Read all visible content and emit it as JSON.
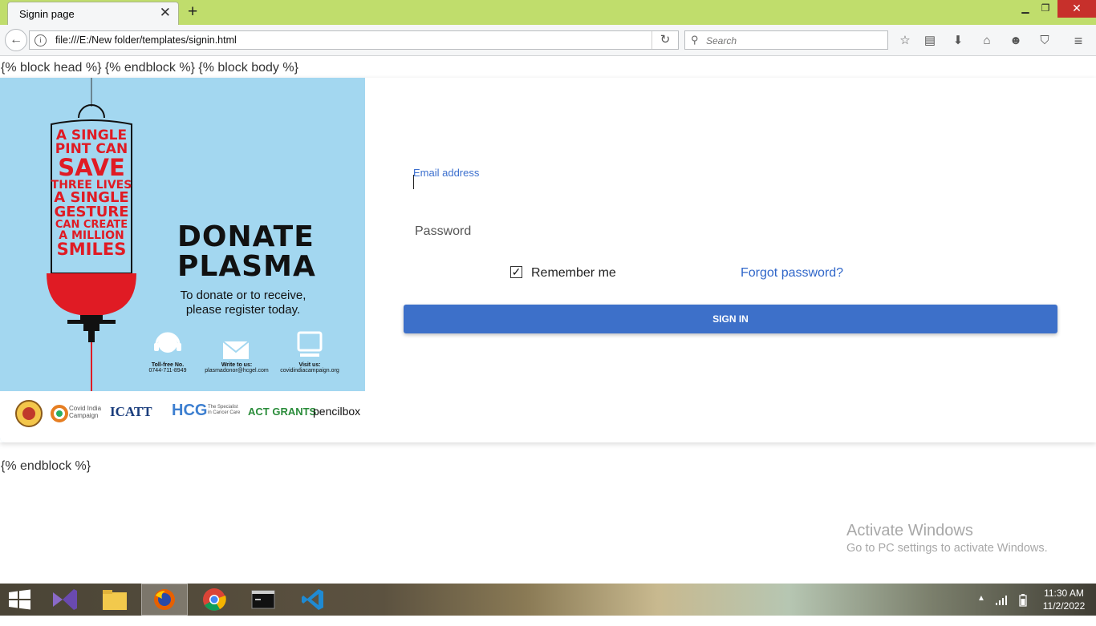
{
  "browser": {
    "tab_title": "Signin page",
    "url": "file:///E:/New folder/templates/signin.html",
    "search_placeholder": "Search"
  },
  "page": {
    "template_head": "{% block head %} {% endblock %} {% block body %}",
    "template_tail": "{% endblock %}",
    "poster": {
      "slogan": [
        "A SINGLE",
        "PINT CAN",
        "SAVE",
        "THREE LIVES",
        "A SINGLE",
        "GESTURE",
        "CAN CREATE",
        "A MILLION",
        "SMILES"
      ],
      "title_line1": "DONATE",
      "title_line2": "PLASMA",
      "subtitle_line1": "To donate or to receive,",
      "subtitle_line2": "please register today.",
      "contacts": [
        {
          "label": "Toll-free No.",
          "value": "0744-711-8949"
        },
        {
          "label": "Write to us:",
          "value": "plasmadonor@hcgel.com"
        },
        {
          "label": "Visit us:",
          "value": "covidindiacampaign.org"
        }
      ],
      "logos": [
        "Covid India Campaign",
        "ICATT",
        "HCG",
        "The Specialist in Cancer Care",
        "ACT GRANTS",
        "pencilbox"
      ]
    },
    "form": {
      "email_label": "Email address",
      "email_value": "",
      "password_placeholder": "Password",
      "remember_label": "Remember me",
      "remember_checked": true,
      "forgot_label": "Forgot password?",
      "signin_label": "SIGN IN"
    },
    "watermark": {
      "title": "Activate Windows",
      "subtitle": "Go to PC settings to activate Windows."
    }
  },
  "taskbar": {
    "time": "11:30 AM",
    "date": "11/2/2022"
  },
  "colors": {
    "titlebar": "#c0dd6c",
    "accent": "#3d70c9",
    "poster_bg": "#a3d7f0",
    "slogan_red": "#e01b24"
  }
}
